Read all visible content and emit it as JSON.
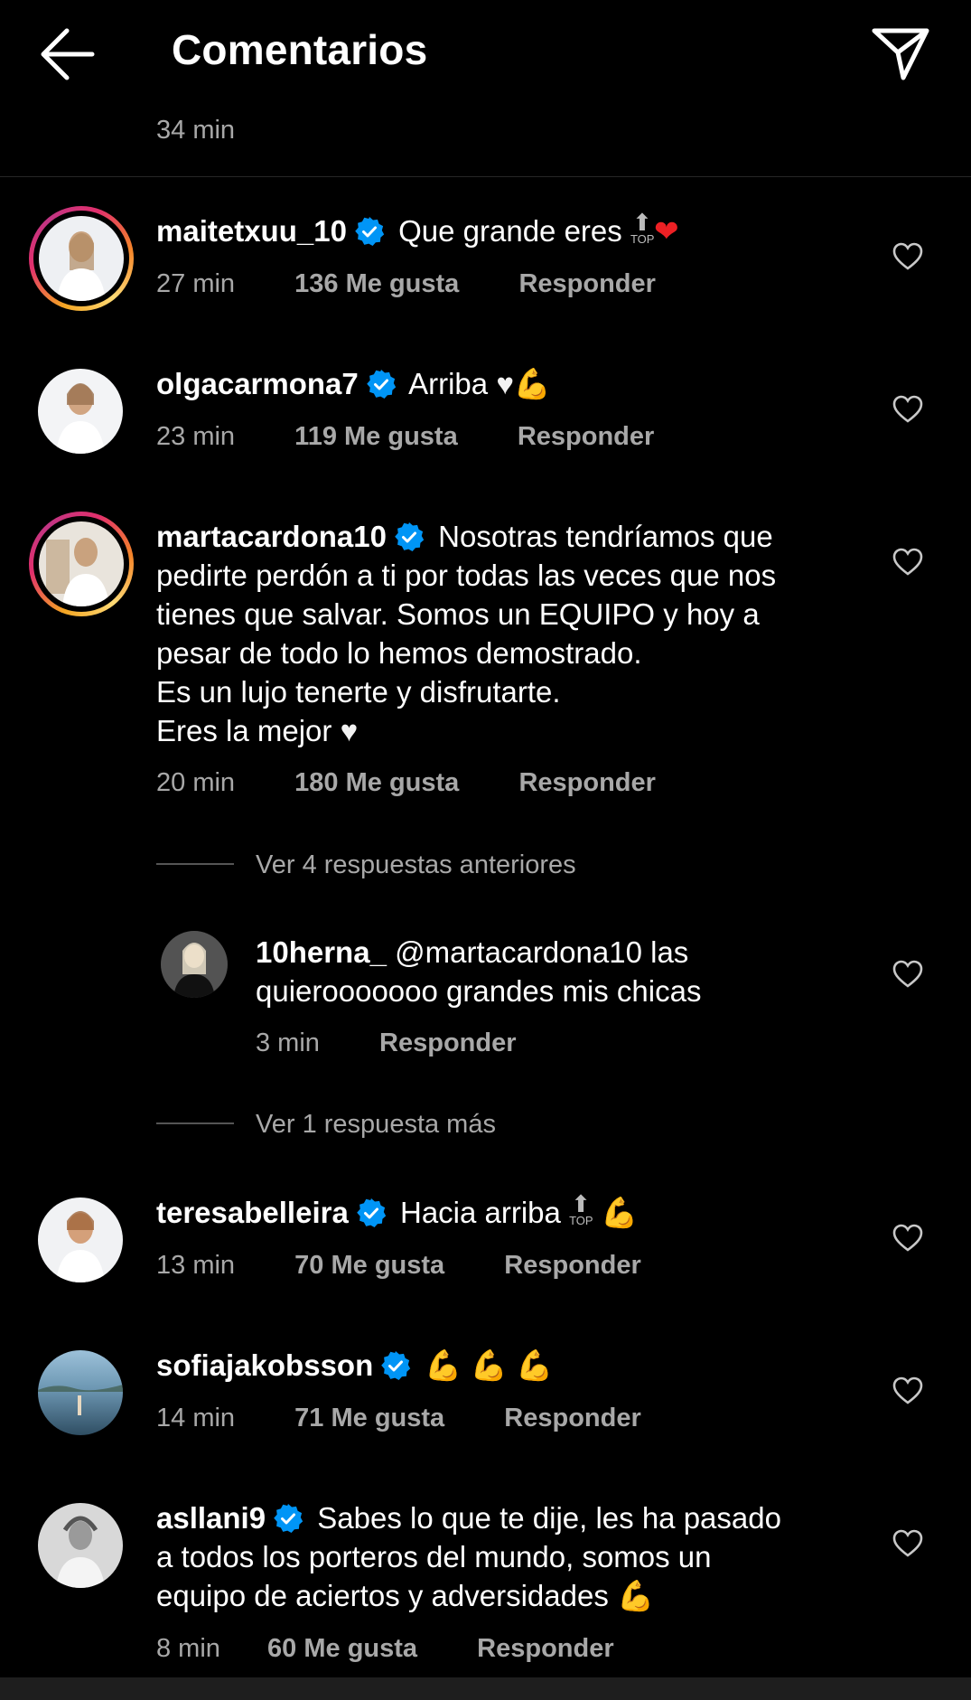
{
  "header": {
    "title": "Comentarios"
  },
  "top_time": "34 min",
  "comments": [
    {
      "username": "maitetxuu_10",
      "text": "Que grande eres",
      "time": "27 min",
      "likes": "136 Me gusta",
      "reply": "Responder",
      "emojis": [
        "top-emoji",
        "red-heart-emoji"
      ],
      "story_ring": true
    },
    {
      "username": "olgacarmona7",
      "text": "Arriba",
      "time": "23 min",
      "likes": "119 Me gusta",
      "reply": "Responder",
      "emojis": [
        "white-heart-emoji",
        "muscle-emoji"
      ],
      "story_ring": false
    },
    {
      "username": "martacardona10",
      "text_lines": [
        "Nosotras tendríamos que",
        "pedirte perdón a ti por todas las veces que nos",
        "tienes que salvar. Somos un EQUIPO y hoy a",
        "pesar de todo lo hemos demostrado.",
        "Es un lujo tenerte y disfrutarte.",
        "Eres la mejor"
      ],
      "time": "20 min",
      "likes": "180 Me gusta",
      "reply": "Responder",
      "emojis": [
        "white-heart-emoji"
      ],
      "story_ring": true
    },
    {
      "username": "teresabelleira",
      "text": "Hacia arriba",
      "time": "13 min",
      "likes": "70 Me gusta",
      "reply": "Responder",
      "emojis": [
        "top-emoji",
        "muscle-emoji"
      ],
      "story_ring": false
    },
    {
      "username": "sofiajakobsson",
      "text": "",
      "time": "14 min",
      "likes": "71 Me gusta",
      "reply": "Responder",
      "emojis": [
        "muscle-emoji",
        "muscle-emoji",
        "muscle-emoji"
      ],
      "story_ring": false
    },
    {
      "username": "asllani9",
      "text_lines": [
        "Sabes lo que te dije, les ha pasado",
        "a todos los porteros del mundo, somos un",
        "equipo de aciertos y adversidades"
      ],
      "time": "8 min",
      "likes": "60 Me gusta",
      "reply": "Responder",
      "emojis": [
        "muscle-emoji"
      ],
      "story_ring": false
    }
  ],
  "replies_section": {
    "view_previous": "Ver 4 respuestas anteriores",
    "reply": {
      "username": "10herna_",
      "mention": "@martacardona10",
      "text_line1": "las",
      "text_line2": "quierooooooo grandes mis chicas",
      "time": "3 min",
      "reply": "Responder"
    },
    "view_more": "Ver 1 respuesta más"
  },
  "colors": {
    "background": "#000000",
    "secondary_text": "#a8a8a8",
    "verified": "#0095f6",
    "divider": "#262626"
  }
}
